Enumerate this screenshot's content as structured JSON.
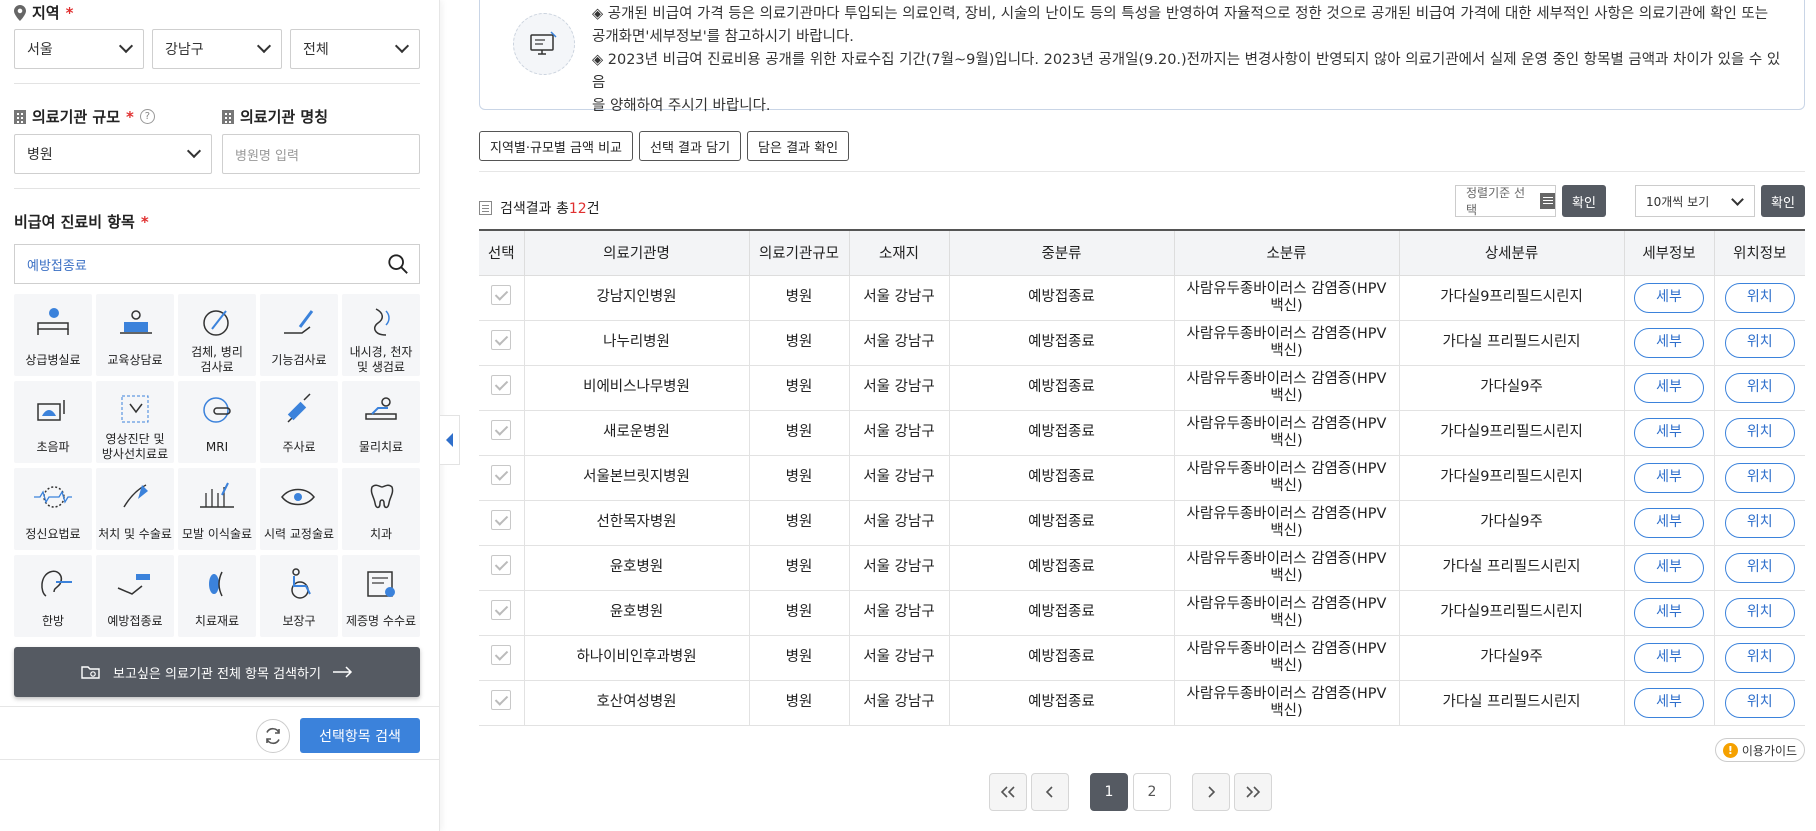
{
  "sidebar": {
    "region_label": "지역",
    "required_mark": "*",
    "region_selects": [
      "서울",
      "강남구",
      "전체"
    ],
    "scale_label": "의료기관 규모",
    "scale_value": "병원",
    "name_label": "의료기관 명칭",
    "name_placeholder": "병원명 입력",
    "category_label": "비급여 진료비 항목",
    "search_value": "예방접종료",
    "categories": [
      {
        "label": "상급병실료",
        "icon": "hospital-bed-icon"
      },
      {
        "label": "교육상담료",
        "icon": "counseling-icon"
      },
      {
        "label": "검체, 병리\n검사료",
        "icon": "pathology-test-icon"
      },
      {
        "label": "기능검사료",
        "icon": "function-test-icon"
      },
      {
        "label": "내시경, 천자\n및 생검료",
        "icon": "endoscopy-icon"
      },
      {
        "label": "초음파",
        "icon": "ultrasound-icon"
      },
      {
        "label": "영상진단 및\n방사선치료료",
        "icon": "imaging-icon"
      },
      {
        "label": "MRI",
        "icon": "mri-icon"
      },
      {
        "label": "주사료",
        "icon": "injection-icon"
      },
      {
        "label": "물리치료",
        "icon": "physical-therapy-icon"
      },
      {
        "label": "정신요법료",
        "icon": "psychotherapy-icon"
      },
      {
        "label": "처치 및 수술료",
        "icon": "surgery-icon"
      },
      {
        "label": "모발 이식술료",
        "icon": "hair-transplant-icon"
      },
      {
        "label": "시력 교정술료",
        "icon": "eye-icon"
      },
      {
        "label": "치과",
        "icon": "tooth-icon"
      },
      {
        "label": "한방",
        "icon": "ear-acupuncture-icon"
      },
      {
        "label": "예방접종료",
        "icon": "vaccination-icon"
      },
      {
        "label": "치료재료",
        "icon": "treatment-material-icon"
      },
      {
        "label": "보장구",
        "icon": "wheelchair-icon"
      },
      {
        "label": "제증명 수수료",
        "icon": "certificate-icon"
      }
    ],
    "all_search_label": "보고싶은 의료기관 전체 항목 검색하기",
    "search_selected_label": "선택항목 검색"
  },
  "notice": {
    "line1": "◈ 공개된 비급여 가격 등은 의료기관마다 투입되는 의료인력, 장비, 시술의 난이도 등의 특성을 반영하여 자율적으로 정한 것으로 공개된 비급여 가격에 대한 세부적인 사항은 의료기관에 확인 또는",
    "line1b": "공개화면'세부정보'를 참고하시기 바랍니다.",
    "line2": "◈ 2023년 비급여 진료비용 공개를 위한 자료수집 기간(7월~9월)입니다. 2023년 공개일(9.20.)전까지는 변경사항이 반영되지 않아 의료기관에서 실제 운영 중인 항목별 금액과 차이가 있을 수 있음",
    "line2b": "을 양해하여 주시기 바랍니다."
  },
  "tabs": [
    "지역별·규모별 금액 비교",
    "선택 결과 담기",
    "담은 결과 확인"
  ],
  "results": {
    "prefix": "검색결과 총",
    "count": "12",
    "suffix": "건",
    "sort_label": "정렬기준 선택",
    "confirm_label": "확인",
    "per_page": "10개씩 보기"
  },
  "table": {
    "headers": [
      "선택",
      "의료기관명",
      "의료기관규모",
      "소재지",
      "중분류",
      "소분류",
      "상세분류",
      "세부정보",
      "위치정보"
    ],
    "detail_label": "세부",
    "location_label": "위치",
    "rows": [
      {
        "name": "강남지인병원",
        "scale": "병원",
        "loc": "서울 강남구",
        "mid": "예방접종료",
        "sub": "사람유두종바이러스 감염증(HPV 백신)",
        "detail": "가다실9프리필드시린지"
      },
      {
        "name": "나누리병원",
        "scale": "병원",
        "loc": "서울 강남구",
        "mid": "예방접종료",
        "sub": "사람유두종바이러스 감염증(HPV 백신)",
        "detail": "가다실 프리필드시린지"
      },
      {
        "name": "비에비스나무병원",
        "scale": "병원",
        "loc": "서울 강남구",
        "mid": "예방접종료",
        "sub": "사람유두종바이러스 감염증(HPV 백신)",
        "detail": "가다실9주"
      },
      {
        "name": "새로운병원",
        "scale": "병원",
        "loc": "서울 강남구",
        "mid": "예방접종료",
        "sub": "사람유두종바이러스 감염증(HPV 백신)",
        "detail": "가다실9프리필드시린지"
      },
      {
        "name": "서울본브릿지병원",
        "scale": "병원",
        "loc": "서울 강남구",
        "mid": "예방접종료",
        "sub": "사람유두종바이러스 감염증(HPV 백신)",
        "detail": "가다실9프리필드시린지"
      },
      {
        "name": "선한목자병원",
        "scale": "병원",
        "loc": "서울 강남구",
        "mid": "예방접종료",
        "sub": "사람유두종바이러스 감염증(HPV 백신)",
        "detail": "가다실9주"
      },
      {
        "name": "윤호병원",
        "scale": "병원",
        "loc": "서울 강남구",
        "mid": "예방접종료",
        "sub": "사람유두종바이러스 감염증(HPV 백신)",
        "detail": "가다실 프리필드시린지"
      },
      {
        "name": "윤호병원",
        "scale": "병원",
        "loc": "서울 강남구",
        "mid": "예방접종료",
        "sub": "사람유두종바이러스 감염증(HPV 백신)",
        "detail": "가다실9프리필드시린지"
      },
      {
        "name": "하나이비인후과병원",
        "scale": "병원",
        "loc": "서울 강남구",
        "mid": "예방접종료",
        "sub": "사람유두종바이러스 감염증(HPV 백신)",
        "detail": "가다실9주"
      },
      {
        "name": "호산여성병원",
        "scale": "병원",
        "loc": "서울 강남구",
        "mid": "예방접종료",
        "sub": "사람유두종바이러스 감염증(HPV 백신)",
        "detail": "가다실 프리필드시린지"
      }
    ]
  },
  "guide_label": "이용가이드",
  "pagination": {
    "pages": [
      "1",
      "2"
    ],
    "current": "1"
  },
  "colors": {
    "primary": "#3b82db",
    "dark": "#555a62",
    "required": "#e03030"
  }
}
